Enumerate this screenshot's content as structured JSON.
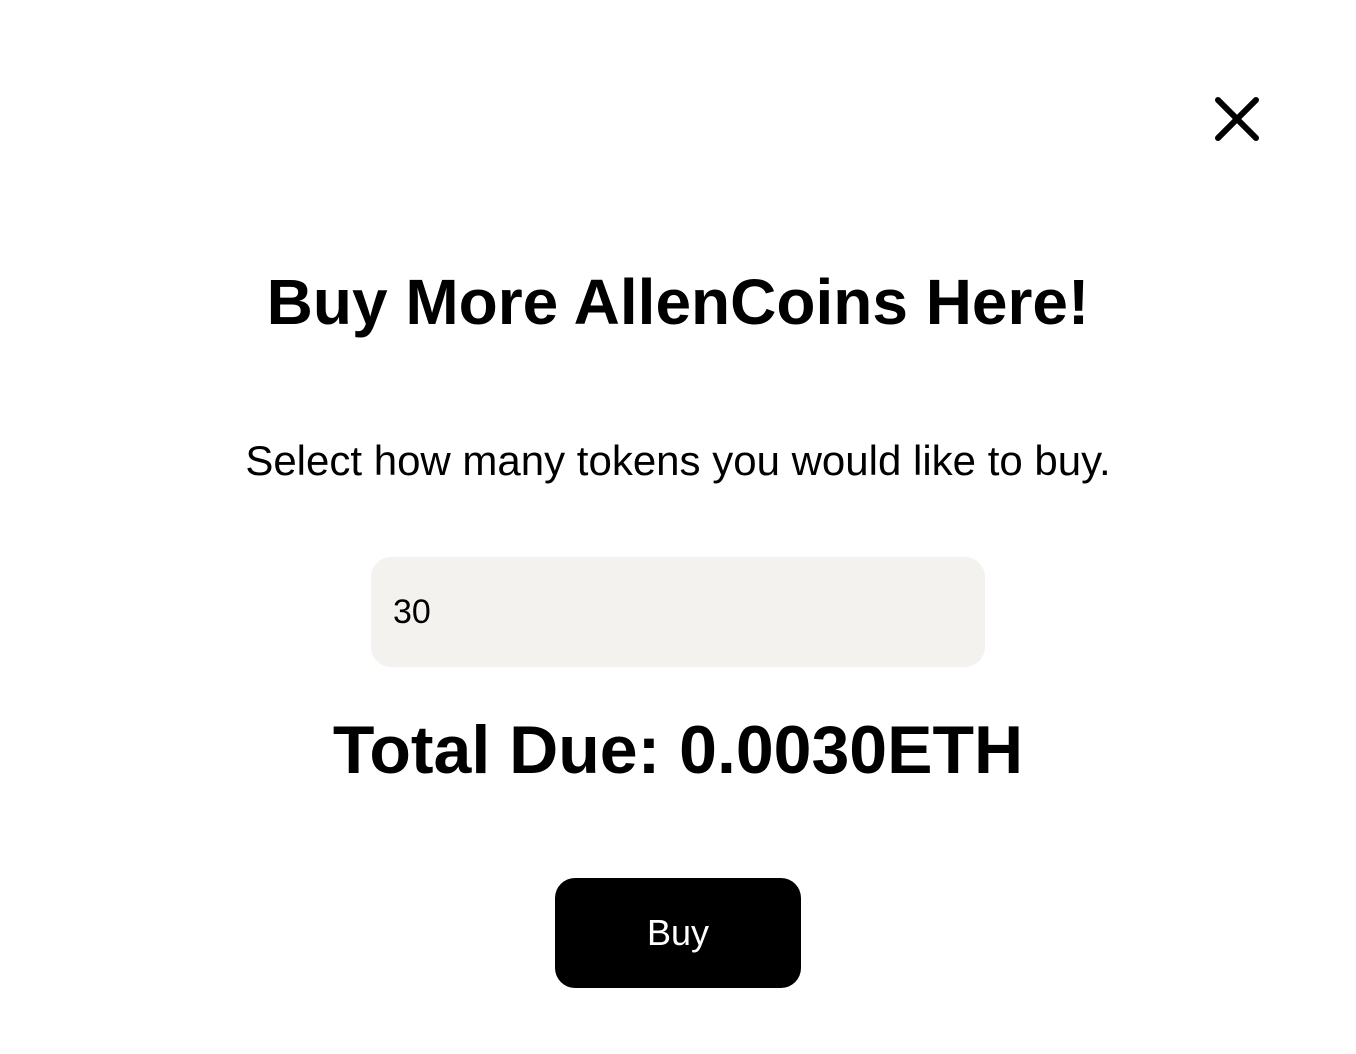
{
  "modal": {
    "close_icon": "close-icon",
    "title": "Buy More AllenCoins Here!",
    "subtitle": "Select how many tokens you would like to buy.",
    "quantity_input": {
      "value": "30"
    },
    "total_due": "Total Due: 0.0030ETH",
    "buy_label": "Buy"
  },
  "colors": {
    "background": "#ffffff",
    "input_background": "#f3f2ee",
    "button_background": "#000000",
    "button_text": "#ffffff",
    "text": "#000000"
  }
}
